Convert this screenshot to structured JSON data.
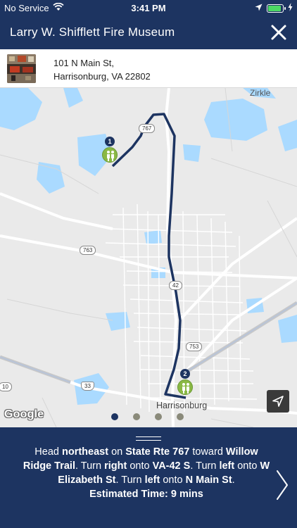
{
  "status_bar": {
    "carrier": "No Service",
    "time": "3:41 PM",
    "battery_level": 0.9,
    "icons": [
      "wifi-icon",
      "location-arrow-icon",
      "battery-icon",
      "charging-bolt-icon"
    ]
  },
  "nav": {
    "title": "Larry W. Shifflett Fire Museum",
    "close_icon": "close-icon"
  },
  "location": {
    "address_line1": "101 N Main St,",
    "address_line2": "Harrisonburg, VA 22802"
  },
  "map": {
    "labels": {
      "zirkle": "Zirkle",
      "harrisonburg": "Harrisonburg"
    },
    "road_shields": {
      "r767": "767",
      "r763": "763",
      "r42": "42",
      "r753": "753",
      "r33": "33",
      "r10": "10"
    },
    "markers": [
      {
        "number": "1",
        "icon": "family-icon"
      },
      {
        "number": "2",
        "icon": "family-icon"
      }
    ],
    "attribution": "Google",
    "locate_icon": "navigation-arrow-icon",
    "route_color": "#1d3461",
    "marker_color": "#8ab845"
  },
  "pagination": {
    "count": 4,
    "active_index": 0
  },
  "directions": {
    "p1": "Head ",
    "b1": "northeast",
    "p2": " on ",
    "b2": "State Rte 767",
    "p3": " toward ",
    "b3": "Willow Ridge Trail",
    "p4": ". Turn ",
    "b4": "right",
    "p5": " onto ",
    "b5": "VA-42 S",
    "p6": ". Turn ",
    "b6": "left",
    "p7": " onto ",
    "b7": "W Elizabeth St",
    "p8": ". Turn ",
    "b8": "left",
    "p9": " onto ",
    "b9": "N Main St",
    "p10": ".",
    "estimated_label": "Estimated Time: 9 mins",
    "next_icon": "chevron-right-icon",
    "handle_icon": "drag-handle-icon"
  },
  "colors": {
    "header_bg": "#1d3461",
    "map_bg": "#eaeaea",
    "water": "#aadaff"
  }
}
